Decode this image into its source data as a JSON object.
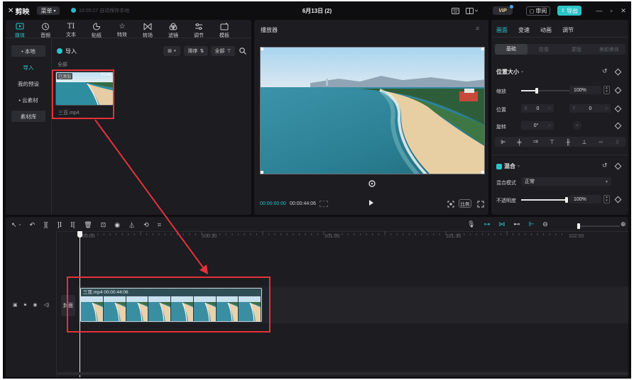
{
  "app": {
    "logo": "剪映",
    "menu_label": "菜单",
    "save_status": "10:05:27 自动保存本地",
    "doc_title": "6月13日 (2)",
    "vip_label": "VIP",
    "review_label": "审阅",
    "export_label": "导出"
  },
  "media": {
    "tabs": [
      {
        "label": "媒体",
        "icon": "media-icon"
      },
      {
        "label": "音频",
        "icon": "audio-icon"
      },
      {
        "label": "文本",
        "icon": "text-icon"
      },
      {
        "label": "贴纸",
        "icon": "sticker-icon"
      },
      {
        "label": "特效",
        "icon": "effects-icon"
      },
      {
        "label": "转场",
        "icon": "transition-icon"
      },
      {
        "label": "滤镜",
        "icon": "filter-icon"
      },
      {
        "label": "调节",
        "icon": "adjust-icon"
      },
      {
        "label": "模板",
        "icon": "template-icon"
      }
    ],
    "sidebar": [
      "• 本地",
      "导入",
      "我的预设",
      "• 云素材",
      "素材库"
    ],
    "import_label": "导入",
    "sort_label": "排序",
    "all_label": "全部",
    "filter_all": "全部",
    "item": {
      "badge": "已添加",
      "duration": "00:45",
      "filename": "三亚.mp4"
    }
  },
  "player": {
    "title": "播放器",
    "current_time": "00:00:00:00",
    "total_time": "00:00:44:06",
    "ratio_label": "比例"
  },
  "props": {
    "tabs": [
      "画面",
      "变速",
      "动画",
      "调节"
    ],
    "subtabs": [
      "基础",
      "抠像",
      "蒙版",
      "美颜美体"
    ],
    "position_size": "位置大小",
    "scale_label": "缩放",
    "scale_value": "100%",
    "scale_level": 0.25,
    "position_label": "位置",
    "x_label": "X",
    "x_value": "0",
    "y_label": "Y",
    "y_value": "0",
    "rotate_label": "旋转",
    "rotate_value": "0°",
    "blend_label": "混合",
    "blend_mode_label": "混合模式",
    "blend_mode_value": "正常",
    "opacity_label": "不透明度",
    "opacity_value": "100%",
    "opacity_level": 1.0
  },
  "timeline": {
    "ruler": [
      "00:00",
      "100:30",
      "101:00",
      "101:30",
      "102:00"
    ],
    "cover_label": "封面",
    "clip_label": "三亚.mp4  00:00:44:06"
  }
}
